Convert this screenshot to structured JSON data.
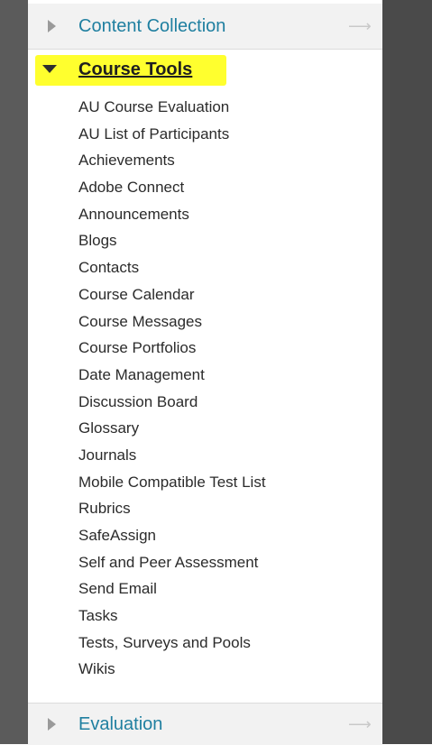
{
  "menu": {
    "sections_before": [
      {
        "label": "Content Collection",
        "state": "collapsed"
      }
    ],
    "open_section": {
      "label": "Course Tools",
      "state": "expanded",
      "highlight_color": "#ffff2e",
      "items": [
        "AU Course Evaluation",
        "AU List of Participants",
        "Achievements",
        "Adobe Connect",
        "Announcements",
        "Blogs",
        "Contacts",
        "Course Calendar",
        "Course Messages",
        "Course Portfolios",
        "Date Management",
        "Discussion Board",
        "Glossary",
        "Journals",
        "Mobile Compatible Test List",
        "Rubrics",
        "SafeAssign",
        "Self and Peer Assessment",
        "Send Email",
        "Tasks",
        "Tests, Surveys and Pools",
        "Wikis"
      ],
      "highlighted_item": "Rubrics"
    },
    "sections_after": [
      {
        "label": "Evaluation",
        "state": "collapsed"
      }
    ]
  },
  "colors": {
    "link": "#1f7fa0",
    "highlight": "#ffff2e",
    "dark_rail": "#4a4a4a"
  },
  "icons": {
    "collapsed": "triangle-right-icon",
    "expanded": "triangle-down-icon",
    "go": "arrow-right-icon"
  }
}
